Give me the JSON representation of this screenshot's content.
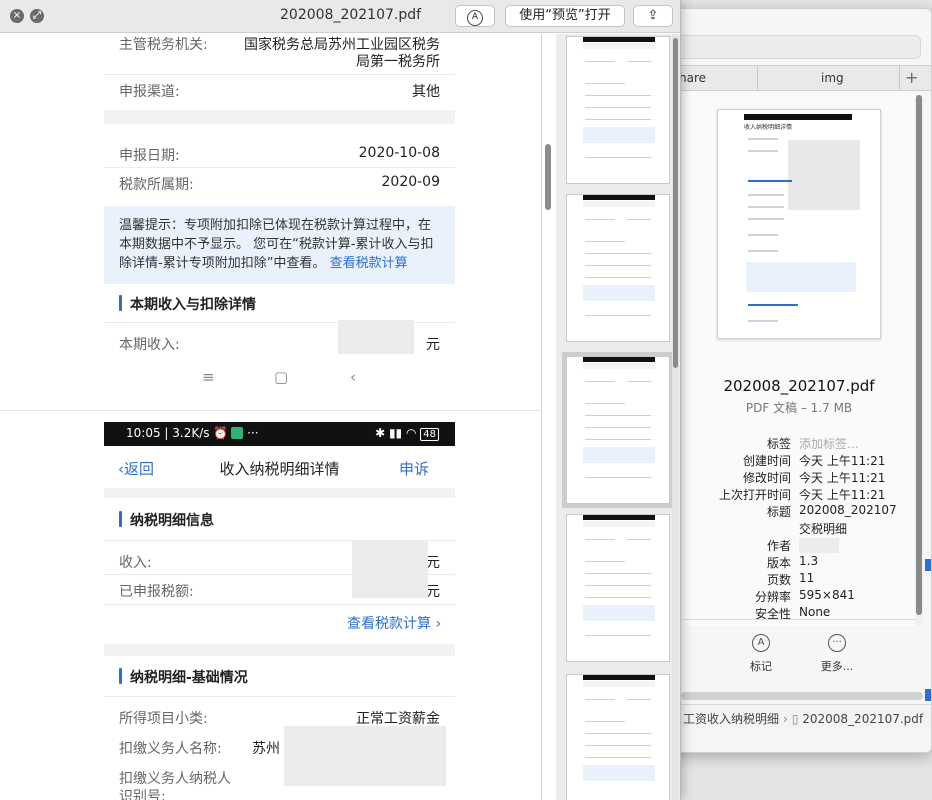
{
  "finder": {
    "tabs": [
      "hare",
      "img"
    ],
    "file_name": "202008_202107.pdf",
    "file_kind": "PDF 文稿 – 1.7 MB",
    "meta": [
      {
        "key": "标签",
        "value": "添加标签…",
        "placeholder": true
      },
      {
        "key": "创建时间",
        "value": "今天 上午11:21"
      },
      {
        "key": "修改时间",
        "value": "今天 上午11:21"
      },
      {
        "key": "上次打开时间",
        "value": "今天 上午11:21"
      },
      {
        "key": "标题",
        "value": "202008_202107"
      },
      {
        "key": "",
        "value": "交税明细"
      },
      {
        "key": "作者",
        "value": ""
      },
      {
        "key": "版本",
        "value": "1.3"
      },
      {
        "key": "页数",
        "value": "11"
      },
      {
        "key": "分辨率",
        "value": "595×841"
      },
      {
        "key": "安全性",
        "value": "None"
      }
    ],
    "actions": {
      "markup": "标记",
      "more": "更多..."
    },
    "pathbar": {
      "folder": "工资收入纳税明细",
      "file": "202008_202107.pdf"
    },
    "thumb_header": "收入纳税明细详情"
  },
  "preview": {
    "title": "202008_202107.pdf",
    "open_with_label": "使用“预览”打开"
  },
  "page1": {
    "rows_top": [
      {
        "key": "主管税务机关:",
        "value_l1": "国家税务总局苏州工业园区税务",
        "value_l2": "局第一税务所"
      },
      {
        "key": "申报渠道:",
        "value": "其他"
      }
    ],
    "date_rows": [
      {
        "key": "申报日期:",
        "value": "2020-10-08"
      },
      {
        "key": "税款所属期:",
        "value": "2020-09"
      }
    ],
    "tip_text": "温馨提示：专项附加扣除已体现在税款计算过程中，在本期数据中不予显示。 您可在“税款计算-累计收入与扣除详情-累计专项附加扣除”中查看。",
    "tip_link": "查看税款计算",
    "section_income": "本期收入与扣除详情",
    "income_key": "本期收入:",
    "income_unit": "元"
  },
  "page2": {
    "status_left": "10:05 | 3.2K/s",
    "status_right": "48",
    "back": "返回",
    "title": "收入纳税明细详情",
    "appeal": "申诉",
    "section_info": "纳税明细信息",
    "income_key": "收入:",
    "income_unit": "元",
    "declared_key": "已申报税额:",
    "declared_unit": "元",
    "view_calc": "查看税款计算",
    "section_basic": "纳税明细-基础情况",
    "item_key": "所得项目小类:",
    "item_value": "正常工资薪金",
    "withholder_key": "扣缴义务人名称:",
    "withholder_value": "苏州",
    "taxid_key_l1": "扣缴义务人纳税人",
    "taxid_key_l2": "识别号:"
  }
}
